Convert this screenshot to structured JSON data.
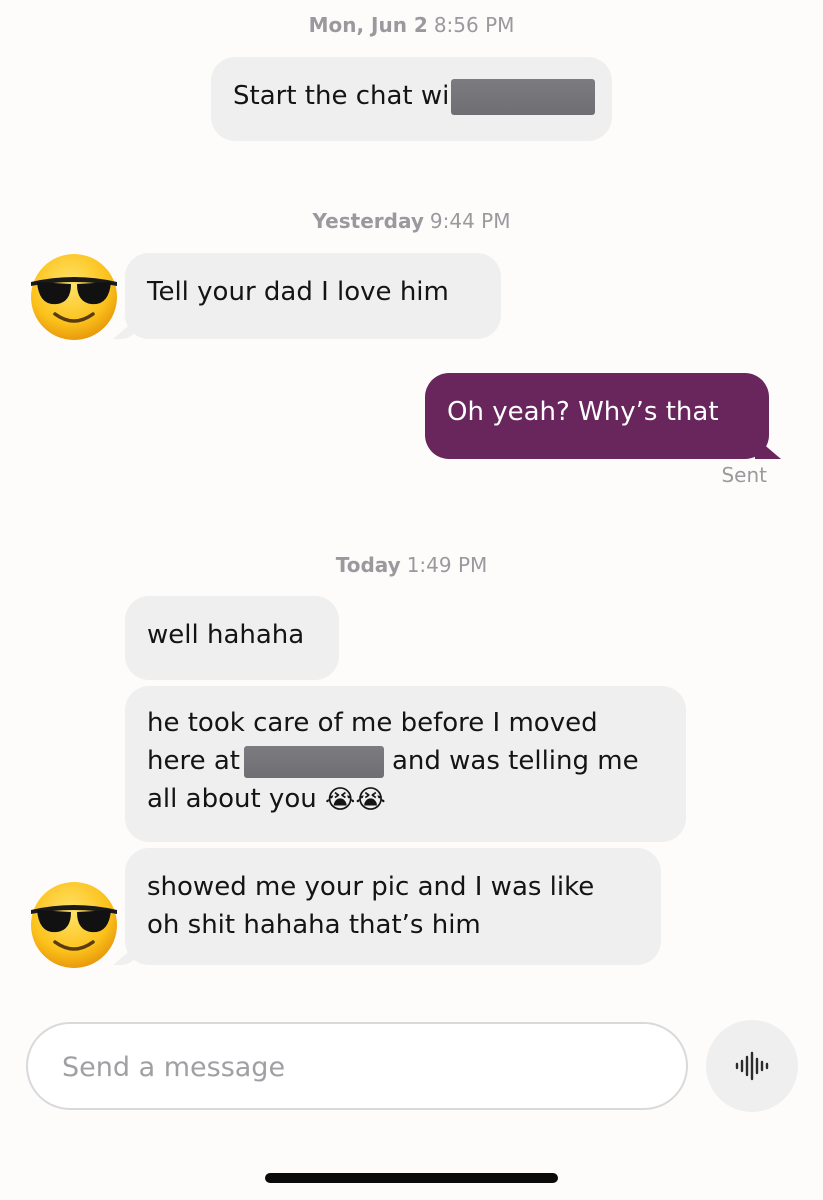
{
  "conversation": {
    "sections": [
      {
        "day": "Mon, Jun 2",
        "time": "8:56 PM"
      },
      {
        "day": "Yesterday",
        "time": "9:44 PM"
      },
      {
        "day": "Today",
        "time": "1:49 PM"
      }
    ],
    "messages": {
      "m1": "Start the chat wi",
      "m2": "Tell your dad I love him",
      "m3": "Oh yeah? Why’s that",
      "m3_status": "Sent",
      "m4": "well hahaha",
      "m5_line1": "he took care of me before I moved",
      "m5_line2_pre": "here at",
      "m5_line2_post": "and was telling me",
      "m5_line3": "all about you",
      "m5_emojis": "😭😭",
      "m6_line1": "showed me your pic and I was like",
      "m6_line2": "oh shit hahaha that’s him"
    }
  },
  "composer": {
    "placeholder": "Send a message",
    "voice_icon": "waveform-icon"
  },
  "icons": {
    "avatar": "sunglasses-face-icon"
  },
  "colors": {
    "outgoing_bubble": "#68265d",
    "incoming_bubble": "#efefef",
    "timestamp": "#9a9a9e"
  }
}
